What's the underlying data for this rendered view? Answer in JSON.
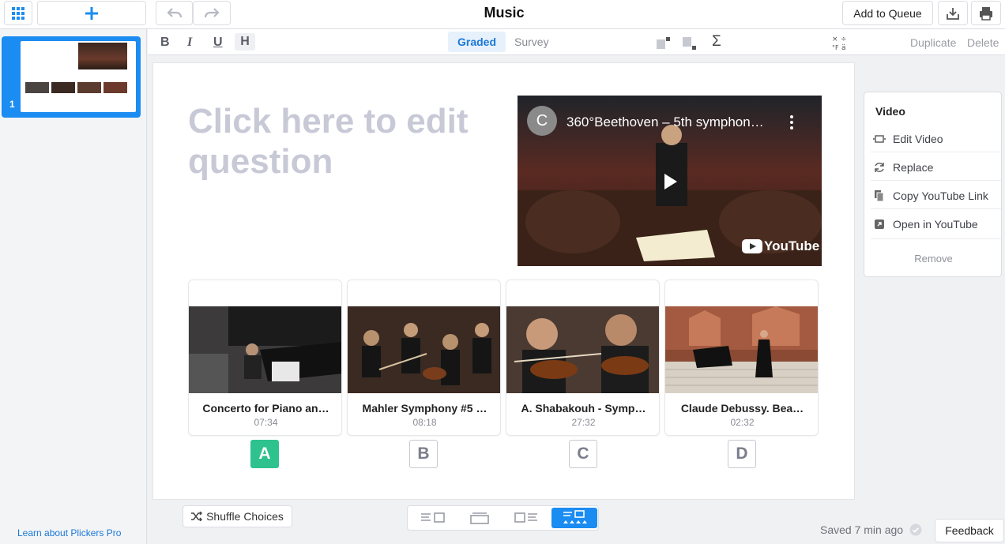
{
  "app": {
    "title": "Music"
  },
  "topbar": {
    "add_to_queue": "Add to Queue"
  },
  "sidebar": {
    "slide_number": "1",
    "learn_link": "Learn about Plickers Pro"
  },
  "format_bar": {
    "bold": "B",
    "italic": "I",
    "underline": "U",
    "heading": "H",
    "graded": "Graded",
    "survey": "Survey",
    "sigma": "Σ",
    "duplicate": "Duplicate",
    "delete": "Delete"
  },
  "question": {
    "placeholder": "Click here to edit question"
  },
  "video": {
    "channel_initial": "C",
    "title": "360°Beethoven – 5th symphon…",
    "brand": "YouTube"
  },
  "choices": [
    {
      "letter": "A",
      "title": "Concerto for Piano an…",
      "duration": "07:34",
      "correct": true
    },
    {
      "letter": "B",
      "title": "Mahler Symphony #5 …",
      "duration": "08:18",
      "correct": false
    },
    {
      "letter": "C",
      "title": "A. Shabakouh - Symp…",
      "duration": "27:32",
      "correct": false
    },
    {
      "letter": "D",
      "title": "Claude Debussy. Bea…",
      "duration": "02:32",
      "correct": false
    }
  ],
  "video_panel": {
    "heading": "Video",
    "items": [
      "Edit Video",
      "Replace",
      "Copy YouTube Link",
      "Open in YouTube"
    ],
    "remove": "Remove"
  },
  "bottom": {
    "shuffle": "Shuffle Choices",
    "saved": "Saved 7 min ago",
    "feedback": "Feedback"
  },
  "colors": {
    "accent": "#1b8cf2",
    "correct": "#2ec28f",
    "placeholder": "#c8c9d6"
  }
}
